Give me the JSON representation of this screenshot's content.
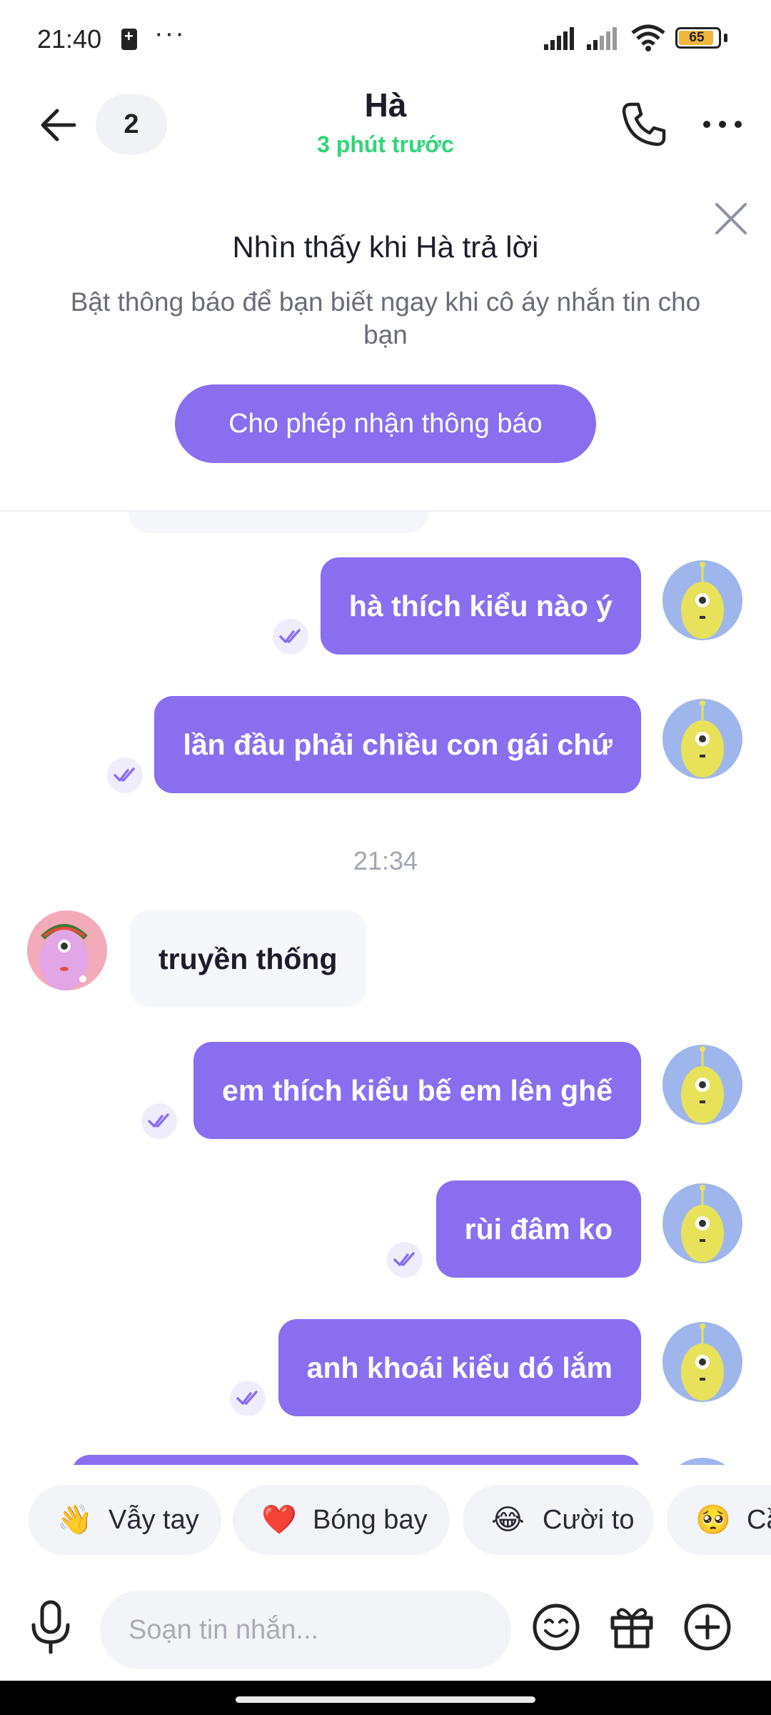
{
  "status_bar": {
    "time": "21:40",
    "more": "···",
    "battery_level": "65",
    "battery_color": "#f0b63d"
  },
  "header": {
    "unread_count": "2",
    "title": "Hà",
    "subtitle": "3 phút trước",
    "subtitle_color": "#2fd67a"
  },
  "notification_banner": {
    "title": "Nhìn thấy khi Hà  trả lời",
    "text": "Bật thông báo để bạn biết ngay khi cô áy nhắn tin cho bạn",
    "button": "Cho phép nhận thông báo"
  },
  "messages": [
    {
      "from": "me",
      "text": "hà thích kiểu nào ý",
      "read": true
    },
    {
      "from": "me",
      "text": "lần đầu phải chiều con gái chứ",
      "read": true
    },
    {
      "type": "time",
      "text": "21:34"
    },
    {
      "from": "her",
      "text": "truyền thống"
    },
    {
      "from": "me",
      "text": "em thích kiểu bế em lên ghế",
      "read": true
    },
    {
      "from": "me",
      "text": "rùi đâm ko",
      "read": true
    },
    {
      "from": "me",
      "text": "anh khoái kiểu dó lắm",
      "read": true
    }
  ],
  "quick_reactions": [
    {
      "emoji": "👋",
      "label": "Vẫy tay"
    },
    {
      "emoji": "❤️",
      "label": "Bóng bay"
    },
    {
      "emoji": "😂",
      "label": "Cười to"
    },
    {
      "emoji": "🥺",
      "label": "Cầ"
    }
  ],
  "composer": {
    "placeholder": "Soạn tin nhắn..."
  },
  "colors": {
    "accent": "#8a6ef0",
    "incoming_bubble": "#f6f7fa"
  }
}
